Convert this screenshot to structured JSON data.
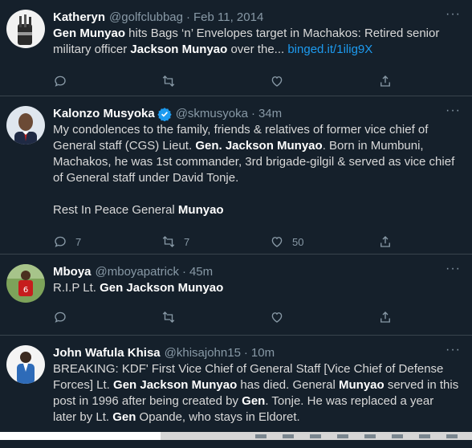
{
  "tweets": [
    {
      "name": "Katheryn",
      "handle": "@golfclubbag",
      "time": "Feb 11, 2014",
      "more": "···",
      "text_parts": [
        {
          "t": "Gen Munyao",
          "b": true
        },
        {
          "t": " hits Bags ‘n’ Envelopes target in Machakos: Retired senior military officer "
        },
        {
          "t": "Jackson Munyao",
          "b": true
        },
        {
          "t": " over the... "
        },
        {
          "t": "binged.it/1ilig9X",
          "link": true
        }
      ],
      "replies": "",
      "retweets": "",
      "likes": ""
    },
    {
      "name": "Kalonzo Musyoka",
      "handle": "@skmusyoka",
      "time": "34m",
      "verified": true,
      "more": "···",
      "paragraphs": [
        [
          {
            "t": "My condolences to the family, friends & relatives of former vice chief of General staff (CGS) Lieut. "
          },
          {
            "t": "Gen. Jackson Munyao",
            "b": true
          },
          {
            "t": ". Born in Mumbuni, Machakos, he was 1st commander, 3rd brigade-gilgil & served as vice chief of General staff under David Tonje."
          }
        ],
        [
          {
            "t": "Rest In Peace General "
          },
          {
            "t": "Munyao",
            "b": true
          }
        ]
      ],
      "replies": "7",
      "retweets": "7",
      "likes": "50"
    },
    {
      "name": "Mboya",
      "handle": "@mboyapatrick",
      "time": "45m",
      "more": "···",
      "text_parts": [
        {
          "t": "R.I.P Lt. "
        },
        {
          "t": "Gen Jackson Munyao",
          "b": true
        }
      ],
      "replies": "",
      "retweets": "",
      "likes": ""
    },
    {
      "name": "John Wafula Khisa",
      "handle": "@khisajohn15",
      "time": "10m",
      "more": "···",
      "text_parts": [
        {
          "t": "BREAKING: KDF' First Vice Chief of General Staff [Vice Chief of Defense Forces] Lt. "
        },
        {
          "t": "Gen Jackson Munyao",
          "b": true
        },
        {
          "t": " has died. General "
        },
        {
          "t": "Munyao",
          "b": true
        },
        {
          "t": " served in this post in 1996 after being created by "
        },
        {
          "t": "Gen",
          "b": true
        },
        {
          "t": ". Tonje. He was replaced a year later by Lt. "
        },
        {
          "t": "Gen",
          "b": true
        },
        {
          "t": " Opande, who stays in Eldoret."
        }
      ]
    }
  ],
  "icons": {
    "reply": "reply-icon",
    "retweet": "retweet-icon",
    "like": "heart-icon",
    "share": "share-icon",
    "verified": "verified-badge-icon",
    "more": "more-options-icon"
  },
  "colors": {
    "background": "#15202b",
    "divider": "#38444d",
    "name": "#ffffff",
    "muted": "#8899a6",
    "body_text": "#d9d9d9",
    "link": "#1d9bf0",
    "verified": "#1d9bf0"
  }
}
